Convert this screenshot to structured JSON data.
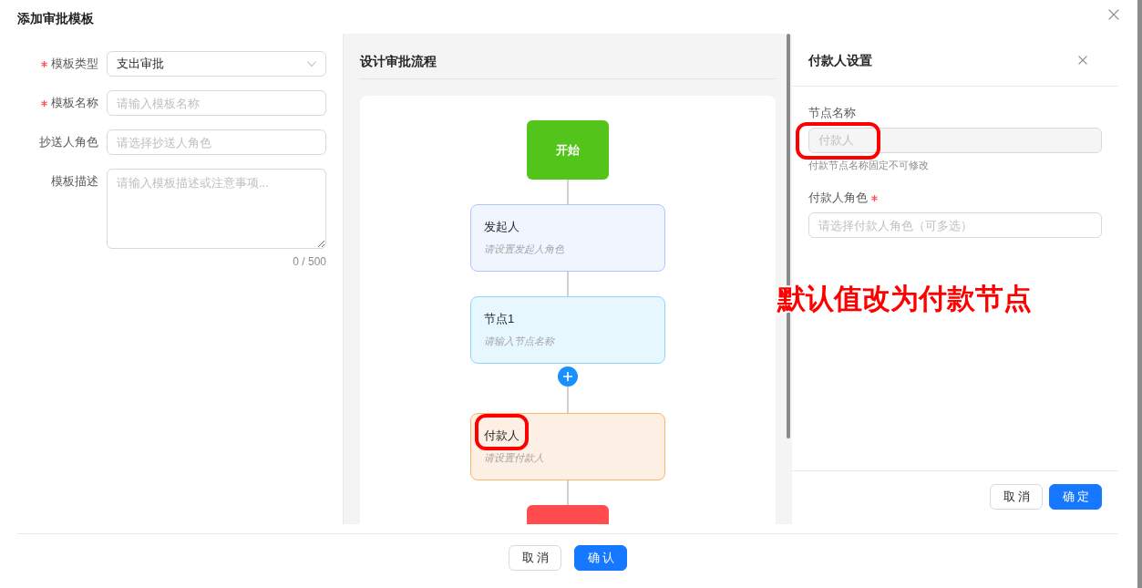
{
  "dialog": {
    "title": "添加审批模板"
  },
  "template_form": {
    "fields": [
      {
        "kind": "select",
        "label": "模板类型",
        "required": true,
        "value": "支出审批"
      },
      {
        "kind": "input",
        "label": "模板名称",
        "required": true,
        "placeholder": "请输入模板名称"
      },
      {
        "kind": "input",
        "label": "抄送人角色",
        "required": false,
        "placeholder": "请选择抄送人角色"
      },
      {
        "kind": "textarea",
        "label": "模板描述",
        "required": false,
        "placeholder": "请输入模板描述或注意事项...",
        "counter": "0 / 500"
      }
    ]
  },
  "flow_designer": {
    "title": "设计审批流程",
    "nodes": [
      {
        "kind": "start",
        "title": "开始",
        "add_button": false,
        "highlighted": false
      },
      {
        "kind": "initiator",
        "title": "发起人",
        "subtitle": "请设置发起人角色",
        "add_button": false,
        "highlighted": false
      },
      {
        "kind": "approver",
        "title": "节点1",
        "subtitle": "请输入节点名称",
        "add_button": true,
        "highlighted": false
      },
      {
        "kind": "payer",
        "title": "付款人",
        "subtitle": "请设置付款人",
        "add_button": false,
        "highlighted": true
      },
      {
        "kind": "end",
        "add_button": false,
        "highlighted": false
      }
    ]
  },
  "settings_panel": {
    "title": "付款人设置",
    "fields": [
      {
        "label": "节点名称",
        "required": false,
        "value": "付款人",
        "disabled": true,
        "highlighted": true,
        "hint": "付款节点名称固定不可修改"
      },
      {
        "label": "付款人角色",
        "required": true,
        "placeholder": "请选择付款人角色（可多选）",
        "disabled": false,
        "highlighted": false
      }
    ],
    "buttons": [
      {
        "kind": "default",
        "label": "取消"
      },
      {
        "kind": "primary",
        "label": "确定"
      }
    ]
  },
  "annotation": {
    "text": "默认值改为付款节点"
  },
  "footer": {
    "buttons": [
      {
        "kind": "default",
        "label": "取消"
      },
      {
        "kind": "primary",
        "label": "确认"
      }
    ]
  }
}
